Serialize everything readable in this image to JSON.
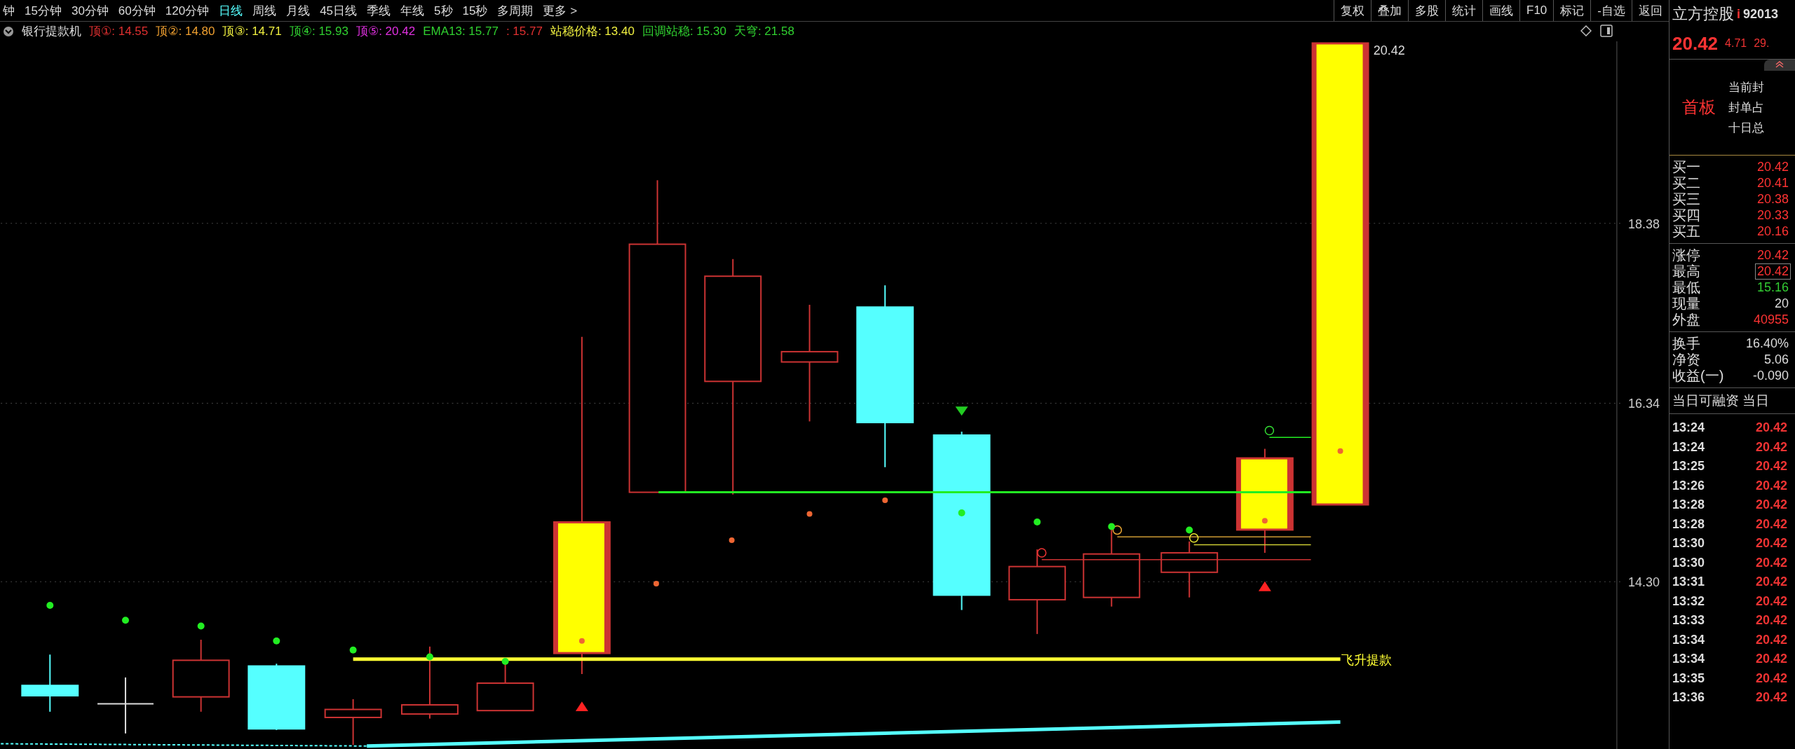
{
  "period_tabs": [
    {
      "label": "钟",
      "selected": false
    },
    {
      "label": "15分钟",
      "selected": false
    },
    {
      "label": "30分钟",
      "selected": false
    },
    {
      "label": "60分钟",
      "selected": false
    },
    {
      "label": "120分钟",
      "selected": false
    },
    {
      "label": "日线",
      "selected": true
    },
    {
      "label": "周线",
      "selected": false
    },
    {
      "label": "月线",
      "selected": false
    },
    {
      "label": "45日线",
      "selected": false
    },
    {
      "label": "季线",
      "selected": false
    },
    {
      "label": "年线",
      "selected": false
    },
    {
      "label": "5秒",
      "selected": false
    },
    {
      "label": "15秒",
      "selected": false
    },
    {
      "label": "多周期",
      "selected": false
    },
    {
      "label": "更多 >",
      "selected": false
    }
  ],
  "toolbar": [
    "复权",
    "叠加",
    "多股",
    "统计",
    "画线",
    "F10",
    "标记",
    "-自选",
    "返回"
  ],
  "indicator": {
    "name": "银行提款机",
    "values": [
      {
        "text": "顶①: 14.55",
        "color": "#e03030"
      },
      {
        "text": "顶②: 14.80",
        "color": "#f0a030"
      },
      {
        "text": "顶③: 14.71",
        "color": "#f0f040"
      },
      {
        "text": "顶④: 15.93",
        "color": "#30d030"
      },
      {
        "text": "顶⑤: 20.42",
        "color": "#e030e0"
      },
      {
        "text": "EMA13: 15.77",
        "color": "#30d030"
      },
      {
        "text": ": 15.77",
        "color": "#e03030"
      },
      {
        "text": "站稳价格: 13.40",
        "color": "#f0f040"
      },
      {
        "text": "回调站稳: 15.30",
        "color": "#30d030"
      },
      {
        "text": "天穹: 21.58",
        "color": "#30d030"
      }
    ]
  },
  "chart": {
    "price_ticks": [
      "18.38",
      "16.34",
      "14.30"
    ],
    "high_label": "20.42",
    "line_label": "飞升提款"
  },
  "quote": {
    "name": "立方控股",
    "info_mark": "i",
    "code": "92013",
    "price": "20.42",
    "change": "4.71",
    "change_pct": "29.",
    "board": "首板",
    "board_notes": [
      "当前封",
      "封单占",
      "十日总"
    ],
    "bids": [
      {
        "label": "买一",
        "value": "20.42"
      },
      {
        "label": "买二",
        "value": "20.41"
      },
      {
        "label": "买三",
        "value": "20.38"
      },
      {
        "label": "买四",
        "value": "20.33"
      },
      {
        "label": "买五",
        "value": "20.16"
      }
    ],
    "stats": [
      {
        "label": "涨停",
        "value": "20.42",
        "color": "#ff3333",
        "boxed": false
      },
      {
        "label": "最高",
        "value": "20.42",
        "color": "#ff3333",
        "boxed": true
      },
      {
        "label": "最低",
        "value": "15.16",
        "color": "#33cc33",
        "boxed": false
      },
      {
        "label": "现量",
        "value": "20",
        "color": "#dddddd",
        "boxed": false
      },
      {
        "label": "外盘",
        "value": "40955",
        "color": "#ff3333",
        "boxed": false
      }
    ],
    "fundamentals": [
      {
        "label": "换手",
        "value": "16.40%"
      },
      {
        "label": "净资",
        "value": "5.06"
      },
      {
        "label": "收益(一)",
        "value": "-0.090"
      }
    ],
    "ticks_header": "当日可融资 当日",
    "ticks": [
      {
        "time": "13:24",
        "price": "20.42"
      },
      {
        "time": "13:24",
        "price": "20.42"
      },
      {
        "time": "13:25",
        "price": "20.42"
      },
      {
        "time": "13:26",
        "price": "20.42"
      },
      {
        "time": "13:28",
        "price": "20.42"
      },
      {
        "time": "13:28",
        "price": "20.42"
      },
      {
        "time": "13:30",
        "price": "20.42"
      },
      {
        "time": "13:30",
        "price": "20.42"
      },
      {
        "time": "13:31",
        "price": "20.42"
      },
      {
        "time": "13:32",
        "price": "20.42"
      },
      {
        "time": "13:33",
        "price": "20.42"
      },
      {
        "time": "13:34",
        "price": "20.42"
      },
      {
        "time": "13:34",
        "price": "20.42"
      },
      {
        "time": "13:35",
        "price": "20.42"
      },
      {
        "time": "13:36",
        "price": "20.42"
      }
    ]
  }
}
